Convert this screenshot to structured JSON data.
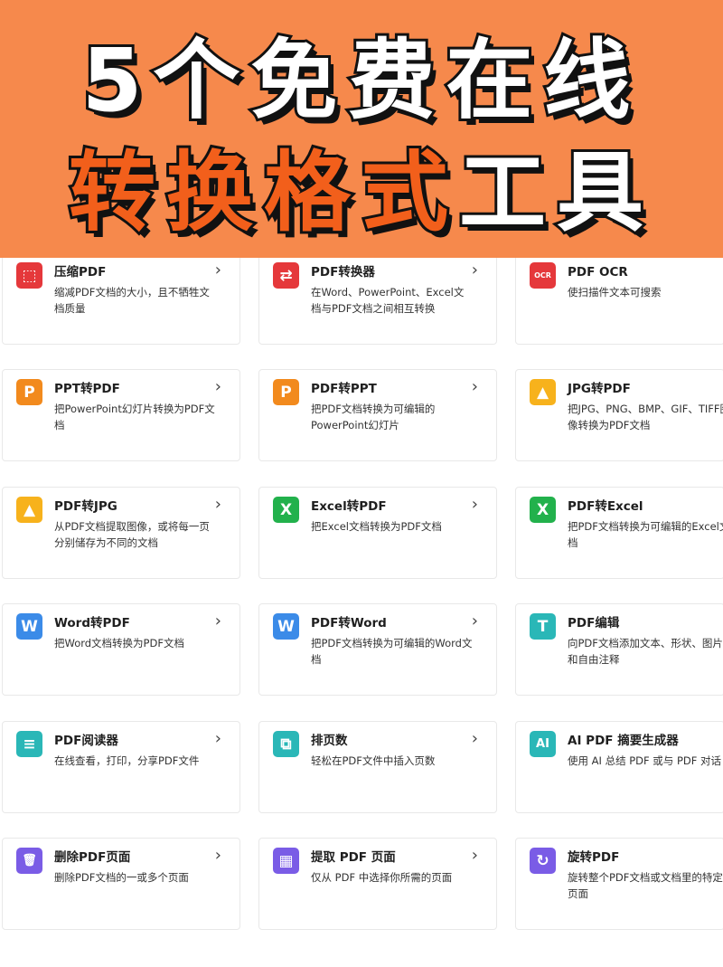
{
  "banner": {
    "line1": "5个免费在线",
    "line2_a": "转换",
    "line2_b": "格式",
    "line2_c": "工具"
  },
  "chevron": "›",
  "tools": [
    {
      "id": "compress-pdf",
      "title": "压缩PDF",
      "desc": "缩减PDF文档的大小，且不牺牲文档质量",
      "icon": "compress-icon",
      "icon_glyph": "⬚",
      "color": "#e5383b"
    },
    {
      "id": "pdf-converter",
      "title": "PDF转换器",
      "desc": "在Word、PowerPoint、Excel文档与PDF文档之间相互转换",
      "icon": "convert-icon",
      "icon_glyph": "⇄",
      "color": "#e5383b"
    },
    {
      "id": "pdf-ocr",
      "title": "PDF OCR",
      "desc": "使扫描件文本可搜索",
      "icon": "ocr-icon",
      "icon_glyph": "OCR",
      "color": "#e5383b"
    },
    {
      "id": "ppt-to-pdf",
      "title": "PPT转PDF",
      "desc": "把PowerPoint幻灯片转换为PDF文档",
      "icon": "powerpoint-icon",
      "icon_glyph": "P",
      "color": "#f28a1d"
    },
    {
      "id": "pdf-to-ppt",
      "title": "PDF转PPT",
      "desc": "把PDF文档转换为可编辑的PowerPoint幻灯片",
      "icon": "powerpoint-icon",
      "icon_glyph": "P",
      "color": "#f28a1d"
    },
    {
      "id": "jpg-to-pdf",
      "title": "JPG转PDF",
      "desc": "把JPG、PNG、BMP、GIF、TIFF图像转换为PDF文档",
      "icon": "image-icon",
      "icon_glyph": "▲",
      "color": "#f7b21c"
    },
    {
      "id": "pdf-to-jpg",
      "title": "PDF转JPG",
      "desc": "从PDF文档提取图像，或将每一页分别储存为不同的文档",
      "icon": "image-icon",
      "icon_glyph": "▲",
      "color": "#f7b21c"
    },
    {
      "id": "excel-to-pdf",
      "title": "Excel转PDF",
      "desc": "把Excel文档转换为PDF文档",
      "icon": "excel-icon",
      "icon_glyph": "X",
      "color": "#22b14c"
    },
    {
      "id": "pdf-to-excel",
      "title": "PDF转Excel",
      "desc": "把PDF文档转换为可编辑的Excel文档",
      "icon": "excel-icon",
      "icon_glyph": "X",
      "color": "#22b14c"
    },
    {
      "id": "word-to-pdf",
      "title": "Word转PDF",
      "desc": "把Word文档转换为PDF文档",
      "icon": "word-icon",
      "icon_glyph": "W",
      "color": "#3b8be8"
    },
    {
      "id": "pdf-to-word",
      "title": "PDF转Word",
      "desc": "把PDF文档转换为可编辑的Word文档",
      "icon": "word-icon",
      "icon_glyph": "W",
      "color": "#3b8be8"
    },
    {
      "id": "pdf-edit",
      "title": "PDF编辑",
      "desc": "向PDF文档添加文本、形状、图片和自由注释",
      "icon": "text-icon",
      "icon_glyph": "T",
      "color": "#2ab7b7"
    },
    {
      "id": "pdf-reader",
      "title": "PDF阅读器",
      "desc": "在线查看，打印，分享PDF文件",
      "icon": "reader-icon",
      "icon_glyph": "≡",
      "color": "#2ab7b7"
    },
    {
      "id": "page-numbers",
      "title": "排页数",
      "desc": "轻松在PDF文件中插入页数",
      "icon": "page-number-icon",
      "icon_glyph": "⧉",
      "color": "#2ab7b7"
    },
    {
      "id": "ai-summary",
      "title": "AI PDF 摘要生成器",
      "desc": "使用 AI 总结 PDF 或与 PDF 对话",
      "icon": "ai-icon",
      "icon_glyph": "AI",
      "color": "#2ab7b7"
    },
    {
      "id": "delete-pages",
      "title": "删除PDF页面",
      "desc": "删除PDF文档的一或多个页面",
      "icon": "trash-icon",
      "icon_glyph": "🗑",
      "color": "#7a5ce6"
    },
    {
      "id": "extract-pages",
      "title": "提取 PDF 页面",
      "desc": "仅从 PDF 中选择你所需的页面",
      "icon": "extract-icon",
      "icon_glyph": "▦",
      "color": "#7a5ce6"
    },
    {
      "id": "rotate-pdf",
      "title": "旋转PDF",
      "desc": "旋转整个PDF文档或文档里的特定页面",
      "icon": "rotate-icon",
      "icon_glyph": "↻",
      "color": "#7a5ce6"
    }
  ]
}
